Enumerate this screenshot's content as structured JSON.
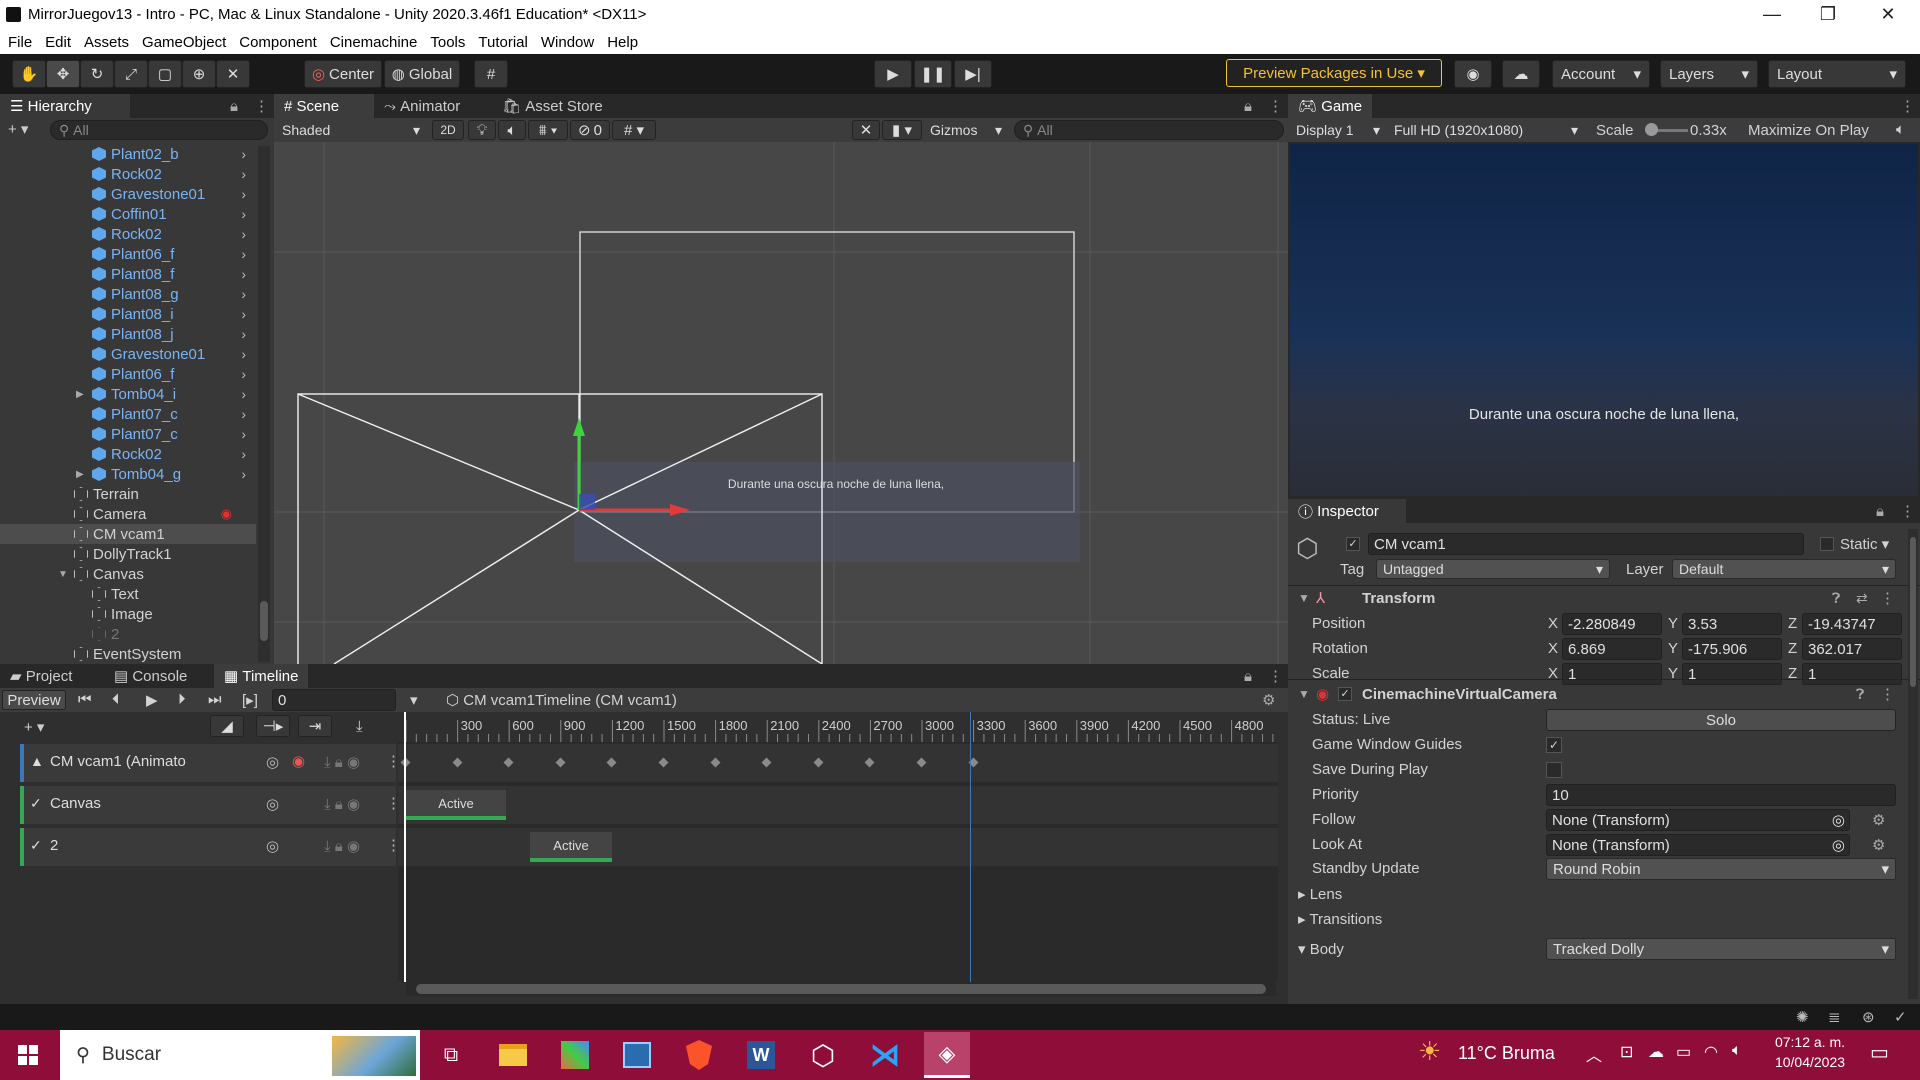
{
  "window": {
    "title": "MirrorJuegov13 - Intro - PC, Mac & Linux Standalone - Unity 2020.3.46f1 Education* <DX11>",
    "minimize": "—",
    "maximize": "❐",
    "close": "✕"
  },
  "menu": [
    "File",
    "Edit",
    "Assets",
    "GameObject",
    "Component",
    "Cinemachine",
    "Tools",
    "Tutorial",
    "Window",
    "Help"
  ],
  "toolbar": {
    "pivot": "Center",
    "space": "Global",
    "preview_packages": "Preview Packages in Use",
    "account": "Account",
    "layers": "Layers",
    "layout": "Layout"
  },
  "hierarchy": {
    "tab": "Hierarchy",
    "search_placeholder": "All",
    "items": [
      {
        "label": "Plant02_b",
        "type": "prefab"
      },
      {
        "label": "Rock02",
        "type": "prefab"
      },
      {
        "label": "Gravestone01",
        "type": "prefab"
      },
      {
        "label": "Coffin01",
        "type": "prefab"
      },
      {
        "label": "Rock02",
        "type": "prefab"
      },
      {
        "label": "Plant06_f",
        "type": "prefab"
      },
      {
        "label": "Plant08_f",
        "type": "prefab"
      },
      {
        "label": "Plant08_g",
        "type": "prefab"
      },
      {
        "label": "Plant08_i",
        "type": "prefab"
      },
      {
        "label": "Plant08_j",
        "type": "prefab"
      },
      {
        "label": "Gravestone01",
        "type": "prefab"
      },
      {
        "label": "Plant06_f",
        "type": "prefab"
      },
      {
        "label": "Tomb04_i",
        "type": "prefab"
      },
      {
        "label": "Plant07_c",
        "type": "prefab"
      },
      {
        "label": "Plant07_c",
        "type": "prefab"
      },
      {
        "label": "Rock02",
        "type": "prefab"
      },
      {
        "label": "Tomb04_g",
        "type": "prefab"
      },
      {
        "label": "Terrain",
        "type": "object"
      },
      {
        "label": "Camera",
        "type": "object"
      },
      {
        "label": "CM vcam1",
        "type": "object"
      },
      {
        "label": "DollyTrack1",
        "type": "object"
      },
      {
        "label": "Canvas",
        "type": "object"
      },
      {
        "label": "Text",
        "type": "object"
      },
      {
        "label": "Image",
        "type": "object"
      },
      {
        "label": "2",
        "type": "disabled"
      },
      {
        "label": "EventSystem",
        "type": "object"
      }
    ]
  },
  "scene": {
    "tabs": [
      "Scene",
      "Animator",
      "Asset Store"
    ],
    "shading": "Shaded",
    "mode2d": "2D",
    "hidden_count": "0",
    "gizmos": "Gizmos",
    "search_placeholder": "All",
    "caption": "Durante una oscura noche de luna llena,"
  },
  "game": {
    "tab": "Game",
    "display": "Display 1",
    "resolution": "Full HD (1920x1080)",
    "scale_label": "Scale",
    "scale_value": "0.33x",
    "maximize": "Maximize On Play",
    "caption": "Durante una oscura noche de luna llena,"
  },
  "inspector": {
    "tab": "Inspector",
    "object_name": "CM vcam1",
    "static": "Static",
    "tag_label": "Tag",
    "tag": "Untagged",
    "layer_label": "Layer",
    "layer": "Default",
    "transform": {
      "title": "Transform",
      "position": {
        "label": "Position",
        "x": "-2.280849",
        "y": "3.53",
        "z": "-19.43747"
      },
      "rotation": {
        "label": "Rotation",
        "x": "6.869",
        "y": "-175.906",
        "z": "362.017"
      },
      "scale": {
        "label": "Scale",
        "x": "1",
        "y": "1",
        "z": "1"
      }
    },
    "vcam": {
      "title": "CinemachineVirtualCamera",
      "status": "Status: Live",
      "solo": "Solo",
      "guides": "Game Window Guides",
      "save_play": "Save During Play",
      "priority_label": "Priority",
      "priority": "10",
      "follow_label": "Follow",
      "follow": "None (Transform)",
      "lookat_label": "Look At",
      "lookat": "None (Transform)",
      "standby_label": "Standby Update",
      "standby": "Round Robin",
      "lens": "Lens",
      "transitions": "Transitions",
      "body_label": "Body",
      "body": "Tracked Dolly"
    }
  },
  "timeline": {
    "tabs": [
      "Project",
      "Console",
      "Timeline"
    ],
    "preview": "Preview",
    "frame": "0",
    "asset": "CM vcam1Timeline (CM vcam1)",
    "ruler": [
      "300",
      "600",
      "900",
      "1200",
      "1500",
      "1800",
      "2100",
      "2400",
      "2700",
      "3000",
      "3300",
      "3600",
      "3900",
      "4200",
      "4500",
      "4800"
    ],
    "tracks": [
      {
        "label": "CM vcam1 (Animato",
        "kind": "animation"
      },
      {
        "label": "Canvas",
        "kind": "activation",
        "clip": "Active"
      },
      {
        "label": "2",
        "kind": "activation",
        "clip": "Active"
      }
    ]
  },
  "taskbar": {
    "search": "Buscar",
    "weather": "11°C  Bruma",
    "time": "07:12 a. m.",
    "date": "10/04/2023"
  },
  "colors": {
    "accent_blue": "#3a79bb",
    "prefab_blue": "#7bb3f4",
    "taskbar": "#8e0e39",
    "preview_yellow": "#f4c232",
    "active_green": "#34a853"
  }
}
